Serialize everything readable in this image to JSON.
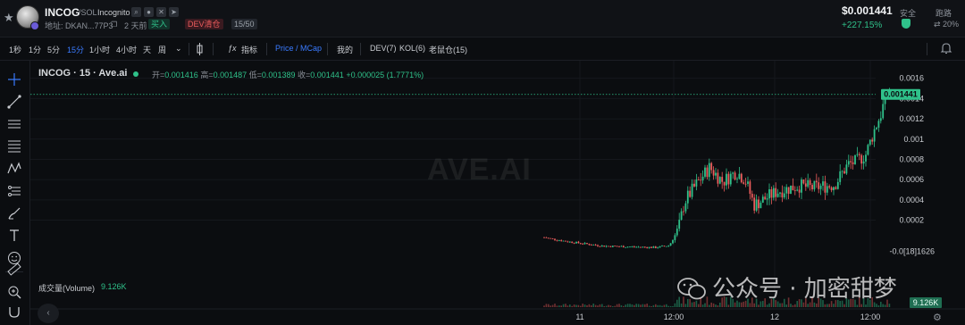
{
  "header": {
    "symbol": "INCOG",
    "pair": "/SOL",
    "full_name": "Incognito",
    "address_label": "地址: DKAN...77P3",
    "age": "2 天前",
    "buy_tag": "买入",
    "dev_tag": "DEV清仓",
    "holder_tag": "15/50",
    "price": "$0.001441",
    "change": "+227.15%",
    "safe_label": "安全",
    "tax_label": "跑路",
    "tax_value": "20%"
  },
  "toolbar": {
    "intervals": [
      "1秒",
      "1分",
      "5分",
      "15分",
      "1小时",
      "4小时",
      "天",
      "周"
    ],
    "active_interval": "15分",
    "indicator_label": "指标",
    "price_mcap_label": "Price / MCap",
    "mine_label": "我的",
    "dev_label": "DEV(7)",
    "kol_label": "KOL(6)",
    "whale_label": "老鼠仓(15)"
  },
  "legend": {
    "title": "INCOG · 15 · Ave.ai",
    "open_label": "开=",
    "open": "0.001416",
    "high_label": "高=",
    "high": "0.001487",
    "low_label": "低=",
    "low": "0.001389",
    "close_label": "收=",
    "close": "0.001441",
    "change": "+0.000025 (1.7771%)",
    "volume_label": "成交量(Volume)",
    "volume_value": "9.126K"
  },
  "watermark": {
    "site": "AVE.AI",
    "wechat": "公众号 · 加密甜梦"
  },
  "chart_data": {
    "type": "candlestick",
    "ylim": [
      -0.00013,
      0.00165
    ],
    "yticks": [
      0.0016,
      0.0014,
      0.0012,
      0.001,
      0.0008,
      0.0006,
      0.0004,
      0.0002
    ],
    "ytick_labels": [
      "0.0016",
      "0.0014",
      "0.0012",
      "0.001",
      "0.0008",
      "0.0006",
      "0.0004",
      "0.0002",
      "-0.0[18]1626"
    ],
    "xtick_labels": [
      "11",
      "12:00",
      "12",
      "12:00"
    ],
    "last_price_label": "0.001441",
    "last_price": 0.001441,
    "volume_axis_label": "9.126K",
    "volume_value": 9126,
    "colors": {
      "up": "#2fc18a",
      "down": "#ec5c5c",
      "background": "#0b0d10"
    },
    "series": [
      {
        "x": [
          "11",
          "12:00",
          "12",
          "12:00"
        ],
        "close": [
          2e-05,
          0.0001,
          0.0005,
          0.001441
        ]
      }
    ]
  }
}
